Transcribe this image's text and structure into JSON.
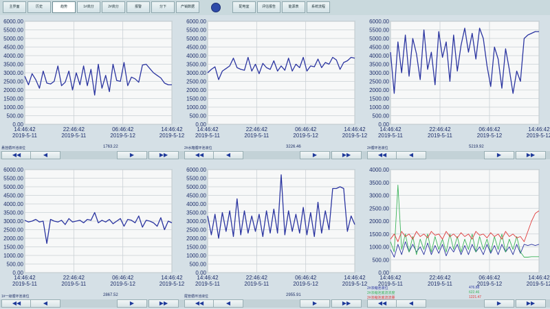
{
  "toolbar": {
    "buttons": [
      "主界面",
      "历史",
      "趋势",
      "1#高分",
      "2#高分",
      "报警",
      "分下",
      "产销数据"
    ],
    "right_buttons": [
      "配电室",
      "评估报告",
      "能源表",
      "系统流程"
    ],
    "active_index": 2
  },
  "colors": {
    "line": "#2a34a0",
    "grid": "#c9d0d4",
    "plot_bg": "#f7f8f8",
    "series_red": "#e03a3a",
    "series_green": "#3cb45a",
    "series_blue": "#2a34a0"
  },
  "nav_icons": [
    "rewind-icon",
    "step-back-icon",
    "step-forward-icon",
    "fast-forward-icon"
  ],
  "nav_glyphs": [
    "◀◀",
    "◀",
    "▶",
    "▶▶"
  ],
  "chart_data": [
    {
      "type": "line",
      "label": "悬挂循环池液位",
      "current_value": "1763.22",
      "ylim": [
        0,
        6000
      ],
      "yticks": [
        "0.00",
        "500.00",
        "1000.00",
        "1500.00",
        "2000.00",
        "2500.00",
        "3000.00",
        "3500.00",
        "4000.00",
        "4500.00",
        "5000.00",
        "5500.00",
        "6000.00"
      ],
      "xticks": [
        [
          "14:46:42",
          "2019-5-11"
        ],
        [
          "22:46:42",
          "2019-5-11"
        ],
        [
          "06:46:42",
          "2019-5-12"
        ],
        [
          "14:46:42",
          "2019-5-12"
        ]
      ],
      "series": [
        {
          "values": [
            2800,
            2300,
            2950,
            2600,
            2100,
            3100,
            2400,
            2350,
            2500,
            3400,
            2250,
            2450,
            3100,
            2000,
            3000,
            2300,
            3400,
            2250,
            3200,
            1700,
            3500,
            2100,
            2850,
            1900,
            3500,
            2550,
            2500,
            3600,
            2250,
            2750,
            2650,
            2450,
            3450,
            3500,
            3250,
            3000,
            2850,
            2700,
            2400,
            2300,
            2300
          ]
        }
      ]
    },
    {
      "type": "line",
      "label": "2#水箱循环池液位",
      "current_value": "3226.46",
      "ylim": [
        0,
        6000
      ],
      "yticks": [
        "0.00",
        "500.00",
        "1000.00",
        "1500.00",
        "2000.00",
        "2500.00",
        "3000.00",
        "3500.00",
        "4000.00",
        "4500.00",
        "5000.00",
        "5500.00",
        "6000.00"
      ],
      "xticks": [
        [
          "14:46:42",
          "2019-5-11"
        ],
        [
          "22:46:42",
          "2019-5-11"
        ],
        [
          "06:46:42",
          "2019-5-12"
        ],
        [
          "14:46:42",
          "2019-5-12"
        ]
      ],
      "series": [
        {
          "values": [
            3000,
            3200,
            3350,
            2600,
            3100,
            3250,
            3400,
            3850,
            3300,
            3200,
            3150,
            3900,
            3100,
            3500,
            2950,
            3550,
            3300,
            3200,
            3700,
            3100,
            3400,
            3150,
            3850,
            3100,
            3500,
            3300,
            3900,
            3100,
            3400,
            3350,
            3800,
            3300,
            3600,
            3500,
            3900,
            3750,
            3200,
            3600,
            3700,
            3900,
            3850
          ]
        }
      ]
    },
    {
      "type": "line",
      "label": "2#循环池液位",
      "current_value": "5219.92",
      "ylim": [
        0,
        6000
      ],
      "yticks": [
        "0.00",
        "500.00",
        "1000.00",
        "1500.00",
        "2000.00",
        "2500.00",
        "3000.00",
        "3500.00",
        "4000.00",
        "4500.00",
        "5000.00",
        "5500.00",
        "6000.00"
      ],
      "xticks": [
        [
          "14:46:42",
          "2019-5-11"
        ],
        [
          "22:46:42",
          "2019-5-11"
        ],
        [
          "06:46:42",
          "2019-5-12"
        ],
        [
          "14:46:42",
          "2019-5-12"
        ]
      ],
      "series": [
        {
          "values": [
            4200,
            1800,
            4800,
            3000,
            5200,
            2800,
            5000,
            4100,
            2600,
            5500,
            3200,
            4200,
            2300,
            5400,
            3900,
            4800,
            2500,
            5200,
            3100,
            4600,
            5600,
            4200,
            5300,
            3800,
            5600,
            5000,
            3400,
            2200,
            4500,
            3800,
            2100,
            4400,
            3200,
            1800,
            3100,
            2500,
            5000,
            5200,
            5300,
            5400,
            5400
          ]
        }
      ]
    },
    {
      "type": "line",
      "label": "1#一级循环池液位",
      "current_value": "2867.52",
      "ylim": [
        0,
        6000
      ],
      "yticks": [
        "0.00",
        "500.00",
        "1000.00",
        "1500.00",
        "2000.00",
        "2500.00",
        "3000.00",
        "3500.00",
        "4000.00",
        "4500.00",
        "5000.00",
        "5500.00",
        "6000.00"
      ],
      "xticks": [
        [
          "14:46:42",
          "2019-5-11"
        ],
        [
          "22:46:42",
          "2019-5-11"
        ],
        [
          "06:46:42",
          "2019-5-12"
        ],
        [
          "14:46:42",
          "2019-5-12"
        ]
      ],
      "series": [
        {
          "values": [
            3050,
            2950,
            3000,
            3100,
            2950,
            3000,
            1700,
            3100,
            3000,
            2950,
            3050,
            2800,
            3150,
            2950,
            3000,
            3050,
            2900,
            3100,
            3050,
            3500,
            2900,
            3050,
            2950,
            3100,
            2850,
            3000,
            3150,
            2700,
            3100,
            3050,
            2900,
            3300,
            2650,
            3050,
            3000,
            2900,
            2700,
            3200,
            2500,
            3000,
            2900
          ]
        }
      ]
    },
    {
      "type": "line",
      "label": "尾管循环池液位",
      "current_value": "2955.91",
      "ylim": [
        0,
        6000
      ],
      "yticks": [
        "0.00",
        "500.00",
        "1000.00",
        "1500.00",
        "2000.00",
        "2500.00",
        "3000.00",
        "3500.00",
        "4000.00",
        "4500.00",
        "5000.00",
        "5500.00",
        "6000.00"
      ],
      "xticks": [
        [
          "14:46:42",
          "2019-5-11"
        ],
        [
          "22:46:42",
          "2019-5-11"
        ],
        [
          "06:46:42",
          "2019-5-12"
        ],
        [
          "14:46:42",
          "2019-5-12"
        ]
      ],
      "series": [
        {
          "values": [
            3300,
            2200,
            3400,
            2000,
            3500,
            2400,
            3600,
            2100,
            4300,
            2200,
            3600,
            2300,
            3300,
            2400,
            3400,
            2100,
            3600,
            2300,
            3700,
            2300,
            5700,
            2200,
            3600,
            2400,
            3400,
            2300,
            3800,
            2200,
            3500,
            2100,
            4100,
            2300,
            3600,
            2500,
            4900,
            4900,
            5000,
            4900,
            2400,
            3300,
            2800
          ]
        }
      ]
    },
    {
      "type": "line",
      "ylim": [
        0,
        4000
      ],
      "yticks": [
        "0.00",
        "500.00",
        "1000.00",
        "1500.00",
        "2000.00",
        "2500.00",
        "3000.00",
        "3500.00",
        "4000.00"
      ],
      "xticks": [
        [
          "14:46:42",
          "2019-5-11"
        ],
        [
          "22:46:42",
          "2019-5-11"
        ],
        [
          "06:46:42",
          "2019-5-12"
        ],
        [
          "14:46:42",
          "2019-5-12"
        ]
      ],
      "series": [
        {
          "name": "2#浓缩池液位",
          "current_value": "476.88",
          "color": "#2a34a0",
          "values": [
            900,
            600,
            1100,
            700,
            1200,
            800,
            1100,
            800,
            1000,
            700,
            1150,
            700,
            1050,
            750,
            1100,
            650,
            1000,
            800,
            1100,
            700,
            1050,
            700,
            1100,
            800,
            1000,
            700,
            1100,
            750,
            1050,
            700,
            1100,
            800,
            1000,
            700,
            1100,
            750,
            1100,
            1050,
            1100,
            1050,
            1100
          ]
        },
        {
          "name": "2#浓缩池底流浓度",
          "current_value": "622.46",
          "color": "#3cb45a",
          "values": [
            1200,
            800,
            3400,
            900,
            1500,
            800,
            1400,
            700,
            1300,
            900,
            1500,
            800,
            1400,
            900,
            1300,
            800,
            1500,
            900,
            1400,
            800,
            1300,
            900,
            1500,
            800,
            1400,
            900,
            1300,
            800,
            1400,
            900,
            1500,
            800,
            1300,
            900,
            1400,
            800,
            600,
            600,
            620,
            620,
            620
          ]
        },
        {
          "name": "2#浓缩池底流流量",
          "current_value": "1221.47",
          "color": "#e03a3a",
          "values": [
            1300,
            1500,
            1200,
            1600,
            1400,
            1500,
            1300,
            1600,
            1400,
            1500,
            1350,
            1600,
            1450,
            1500,
            1300,
            1600,
            1400,
            1500,
            1350,
            1550,
            1400,
            1500,
            1300,
            1600,
            1450,
            1500,
            1350,
            1550,
            1400,
            1500,
            1300,
            1600,
            1400,
            1500,
            1350,
            1400,
            1200,
            1600,
            2000,
            2300,
            2400
          ]
        }
      ]
    }
  ]
}
